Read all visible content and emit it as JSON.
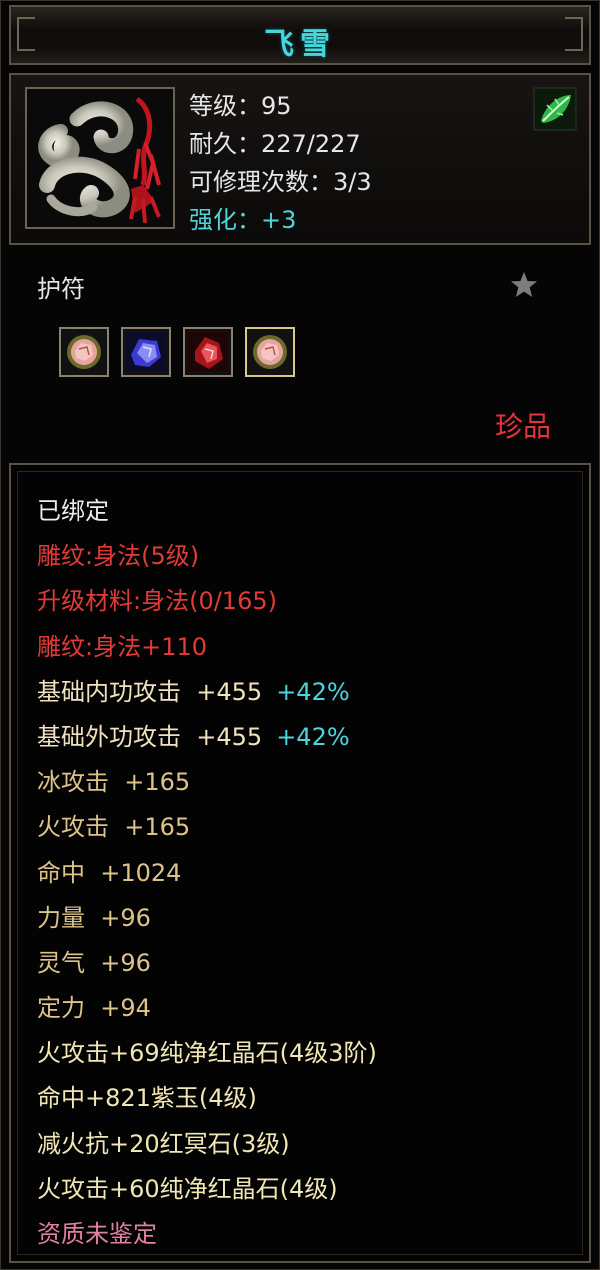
{
  "title": "飞雪",
  "header": {
    "item_icon": "jade-amulet-with-red-tassel",
    "stats": {
      "level": "等级：95",
      "durability": "耐久：227/227",
      "repairs": "可修理次数：3/3",
      "enhance": "强化：+3"
    },
    "badge_icon": "green-leaf-icon"
  },
  "item_type": "护符",
  "star_icon": "star-icon",
  "gem_slots": [
    {
      "icon": "pink-crystal-gem-icon"
    },
    {
      "icon": "blue-crystal-gem-icon"
    },
    {
      "icon": "red-crystal-gem-icon"
    },
    {
      "icon": "pink-crystal-gem-icon",
      "selected": true
    }
  ],
  "rarity": "珍品",
  "properties": [
    {
      "text": "已绑定",
      "color": "#ededed"
    },
    {
      "text": "雕纹:身法(5级)",
      "color": "#e23a36"
    },
    {
      "text": "升级材料:身法(0/165)",
      "color": "#e23a36"
    },
    {
      "text": "雕纹:身法+110",
      "color": "#e23a36"
    },
    {
      "text": "基础内功攻击  +455",
      "ext": "+42%",
      "color": "#efe2bd"
    },
    {
      "text": "基础外功攻击  +455",
      "ext": "+42%",
      "color": "#efe2bd"
    },
    {
      "text": "冰攻击  +165",
      "color": "#ddc389"
    },
    {
      "text": "火攻击  +165",
      "color": "#ddc389"
    },
    {
      "text": "命中  +1024",
      "color": "#ddc389"
    },
    {
      "text": "力量  +96",
      "color": "#ddc389"
    },
    {
      "text": "灵气  +96",
      "color": "#ddc389"
    },
    {
      "text": "定力  +94",
      "color": "#ddc389"
    },
    {
      "text": "火攻击+69纯净红晶石(4级3阶)",
      "color": "#f0e7b4"
    },
    {
      "text": "命中+821紫玉(4级)",
      "color": "#f0e7b4"
    },
    {
      "text": "减火抗+20红冥石(3级)",
      "color": "#f0e7b4"
    },
    {
      "text": "火攻击+60纯净红晶石(4级)",
      "color": "#f0e7b4"
    },
    {
      "text": "资质未鉴定",
      "color": "#e27fa4"
    }
  ]
}
